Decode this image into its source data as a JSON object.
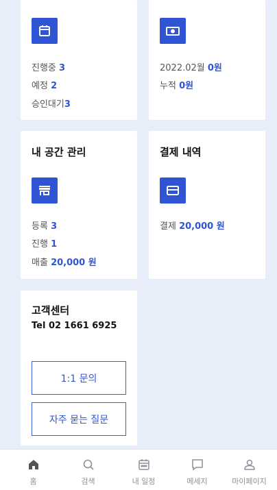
{
  "cards": {
    "schedule": {
      "stats": [
        {
          "label": "진행중 ",
          "value": "3"
        },
        {
          "label": "예정 ",
          "value": "2"
        },
        {
          "label": "승인대기",
          "value": "3"
        }
      ]
    },
    "payout": {
      "stats": [
        {
          "label": "2022.02월 ",
          "value": "0원"
        },
        {
          "label": "누적 ",
          "value": "0원"
        }
      ]
    },
    "space": {
      "title": "내 공간 관리",
      "stats": [
        {
          "label": "등록 ",
          "value": "3"
        },
        {
          "label": "진행 ",
          "value": "1"
        },
        {
          "label": "매출 ",
          "value": "20,000 원"
        }
      ]
    },
    "payment": {
      "title": "결제 내역",
      "stats": [
        {
          "label": "결제 ",
          "value": "20,000 원"
        }
      ]
    },
    "support": {
      "title": "고객센터",
      "phone": "Tel 02 1661 6925",
      "buttons": {
        "inquiry": "1:1 문의",
        "faq": "자주 묻는 질문"
      }
    }
  },
  "tabbar": {
    "items": [
      {
        "label": "홈",
        "icon": "home-icon",
        "active": true
      },
      {
        "label": "검색",
        "icon": "search-icon"
      },
      {
        "label": "내 일정",
        "icon": "calendar-icon"
      },
      {
        "label": "메세지",
        "icon": "message-icon"
      },
      {
        "label": "마이페이지",
        "icon": "user-icon"
      }
    ]
  },
  "colors": {
    "accent": "#2f55d4",
    "background": "#e8eef9",
    "muted": "#8a8f99"
  }
}
